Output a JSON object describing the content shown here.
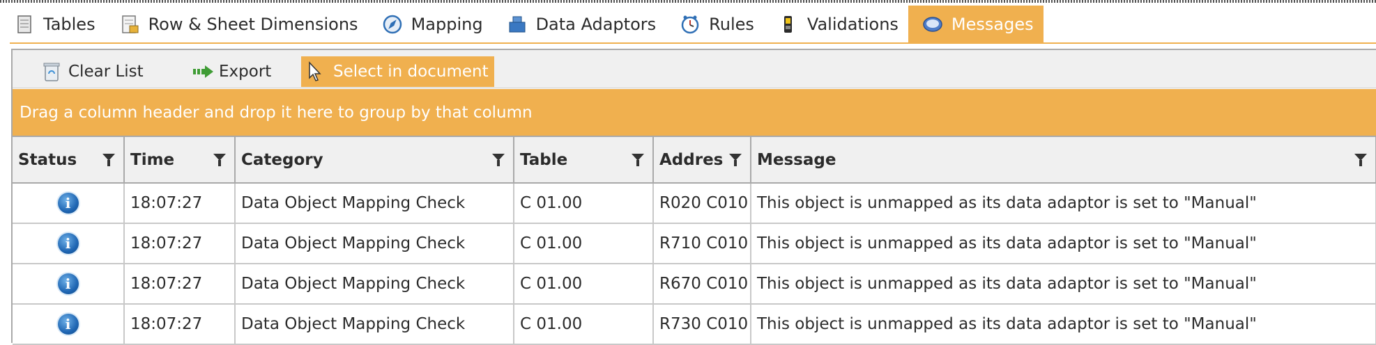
{
  "tabs": [
    {
      "label": "Tables",
      "icon": "tables-icon",
      "active": false
    },
    {
      "label": "Row & Sheet Dimensions",
      "icon": "dimensions-icon",
      "active": false
    },
    {
      "label": "Mapping",
      "icon": "compass-icon",
      "active": false
    },
    {
      "label": "Data Adaptors",
      "icon": "puzzle-icon",
      "active": false
    },
    {
      "label": "Rules",
      "icon": "clock-icon",
      "active": false
    },
    {
      "label": "Validations",
      "icon": "validation-icon",
      "active": false
    },
    {
      "label": "Messages",
      "icon": "messages-icon",
      "active": true
    }
  ],
  "toolbar": {
    "clear_label": "Clear List",
    "export_label": "Export",
    "select_label": "Select in document"
  },
  "group_hint": "Drag a column header and drop it here to group by that column",
  "columns": [
    "Status",
    "Time",
    "Category",
    "Table",
    "Addres",
    "Message"
  ],
  "rows": [
    {
      "status": "info",
      "time": "18:07:27",
      "category": "Data Object Mapping Check",
      "table": "C 01.00",
      "address": "R020 C010",
      "message": "This object is unmapped as its data adaptor is set to \"Manual\""
    },
    {
      "status": "info",
      "time": "18:07:27",
      "category": "Data Object Mapping Check",
      "table": "C 01.00",
      "address": "R710 C010",
      "message": "This object is unmapped as its data adaptor is set to \"Manual\""
    },
    {
      "status": "info",
      "time": "18:07:27",
      "category": "Data Object Mapping Check",
      "table": "C 01.00",
      "address": "R670 C010",
      "message": "This object is unmapped as its data adaptor is set to \"Manual\""
    },
    {
      "status": "info",
      "time": "18:07:27",
      "category": "Data Object Mapping Check",
      "table": "C 01.00",
      "address": "R730 C010",
      "message": "This object is unmapped as its data adaptor is set to \"Manual\""
    }
  ],
  "colors": {
    "accent": "#f0b04f",
    "toolbar_bg": "#f0f0f0",
    "border": "#a9a9a9"
  }
}
